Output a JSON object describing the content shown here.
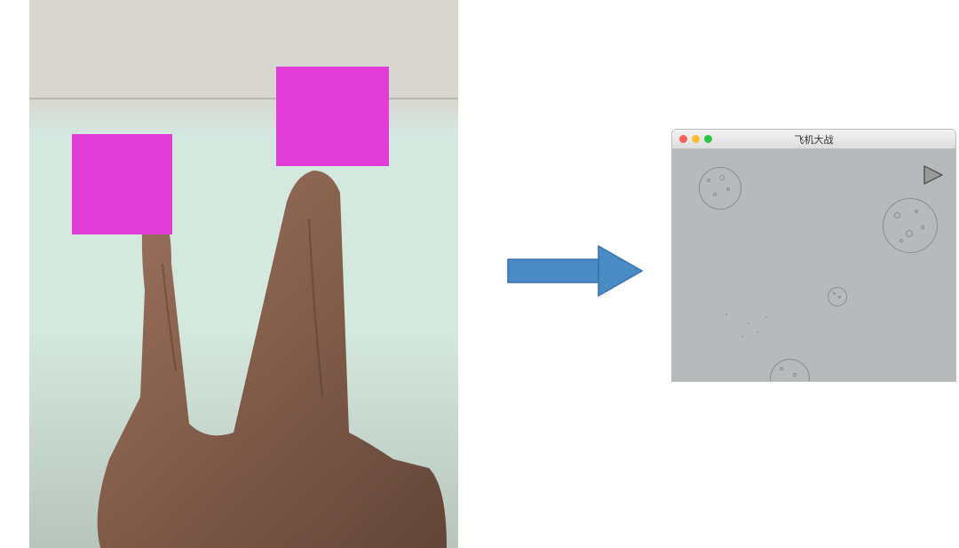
{
  "leftImage": {
    "overlays": [
      {
        "name": "box1",
        "color": "#e23dd8"
      },
      {
        "name": "box2",
        "color": "#e23dd8"
      }
    ]
  },
  "arrow": {
    "direction": "right",
    "fill": "#4a8bc5",
    "stroke": "#3771a8"
  },
  "appWindow": {
    "title": "飞机大战",
    "trafficLights": [
      "red",
      "yellow",
      "green"
    ],
    "gameArea": {
      "background": "#b7babb",
      "asteroids": [
        {
          "id": "ast1",
          "size": "medium"
        },
        {
          "id": "ast2",
          "size": "large"
        },
        {
          "id": "ast3",
          "size": "small"
        },
        {
          "id": "ast4",
          "size": "medium"
        }
      ],
      "ship": {
        "shape": "triangle",
        "position": "top-right"
      }
    }
  }
}
